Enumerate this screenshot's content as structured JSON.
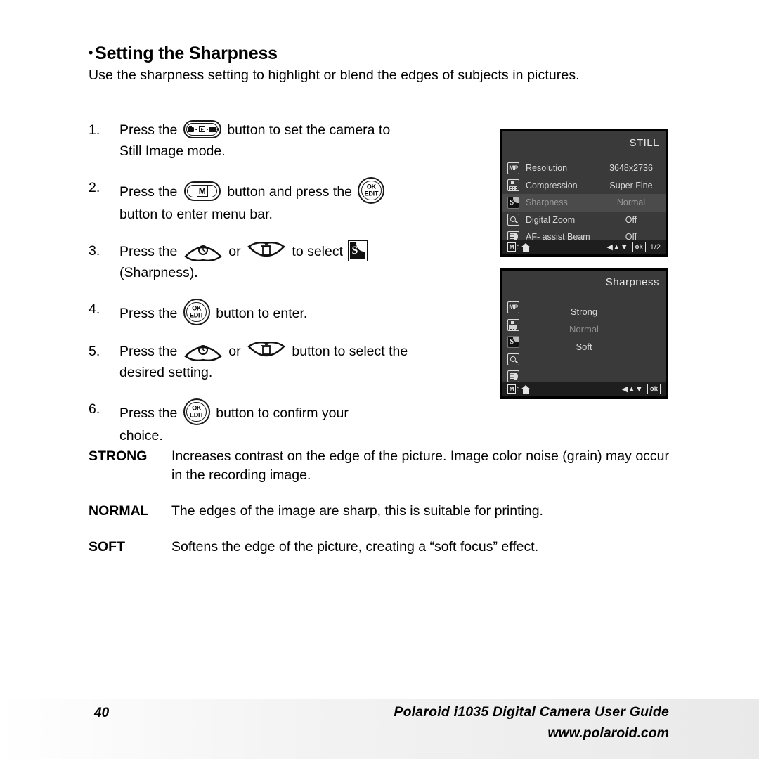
{
  "section": {
    "bullet": "•",
    "heading": "Setting the Sharpness",
    "intro": "Use the sharpness setting to highlight or blend the edges of subjects in pictures."
  },
  "steps": [
    {
      "num": "1.",
      "pre": "Press the",
      "icon": "mode-button-icon",
      "post": "button to set the camera to",
      "line2": "Still Image mode."
    },
    {
      "num": "2.",
      "pre": "Press the",
      "icon": "menu-m-button-icon",
      "mid": "button and press the",
      "icon2": "ok-edit-button-icon",
      "line2": "button to enter menu bar."
    },
    {
      "num": "3.",
      "pre": "Press the",
      "icon": "self-timer-up-button-icon",
      "mid": "or",
      "icon2": "delete-down-button-icon",
      "post": "to select",
      "icon3": "sharpness-icon",
      "line2": "(Sharpness)."
    },
    {
      "num": "4.",
      "pre": "Press the",
      "icon": "ok-edit-button-icon",
      "post": "button to enter."
    },
    {
      "num": "5.",
      "pre": "Press the",
      "icon": "self-timer-up-button-icon",
      "mid": "or",
      "icon2": "delete-down-button-icon",
      "post": "button to select the",
      "line2": "desired setting."
    },
    {
      "num": "6.",
      "pre": "Press the",
      "icon": "ok-edit-button-icon",
      "post": "button to confirm your",
      "line2": "choice."
    }
  ],
  "buttons": {
    "ok_edit": {
      "line1": "OK",
      "line2": "EDIT"
    },
    "menu_m": "M",
    "sharpness_glyph": "S"
  },
  "lcd_still": {
    "title": "STILL",
    "rows": [
      {
        "icon": "mp-resolution-icon",
        "label": "Resolution",
        "value": "3648x2736",
        "selected": false
      },
      {
        "icon": "compression-icon",
        "label": "Compression",
        "value": "Super Fine",
        "selected": false
      },
      {
        "icon": "sharpness-icon",
        "label": "Sharpness",
        "value": "Normal",
        "selected": true
      },
      {
        "icon": "digital-zoom-icon",
        "label": "Digital Zoom",
        "value": "Off",
        "selected": false
      },
      {
        "icon": "af-assist-beam-icon",
        "label": "AF- assist Beam",
        "value": "Off",
        "selected": false
      }
    ],
    "status": {
      "m_label": "M",
      "colon": ":",
      "home_icon": "home-icon",
      "arrows": "◀▲▼",
      "ok_label": "ok",
      "page": "1/2"
    }
  },
  "lcd_sharpness": {
    "title": "Sharpness",
    "icons": [
      "mp-resolution-icon",
      "compression-icon",
      "sharpness-icon",
      "digital-zoom-icon",
      "af-assist-beam-icon"
    ],
    "options": [
      {
        "label": "Strong",
        "dim": false
      },
      {
        "label": "Normal",
        "dim": true
      },
      {
        "label": "Soft",
        "dim": false
      }
    ],
    "status": {
      "m_label": "M",
      "colon": ":",
      "home_icon": "home-icon",
      "arrows": "◀▲▼",
      "ok_label": "ok",
      "page": ""
    }
  },
  "definitions": [
    {
      "term": "STRONG",
      "text": "Increases contrast on the edge of the picture. Image color noise (grain) may occur in the recording image."
    },
    {
      "term": "NORMAL",
      "text": "The edges of the image are sharp, this is suitable for printing."
    },
    {
      "term": "SOFT",
      "text": "Softens the edge of the picture, creating a “soft focus” effect."
    }
  ],
  "footer": {
    "page_number": "40",
    "guide_title": "Polaroid i1035 Digital Camera User Guide",
    "url": "www.polaroid.com"
  }
}
